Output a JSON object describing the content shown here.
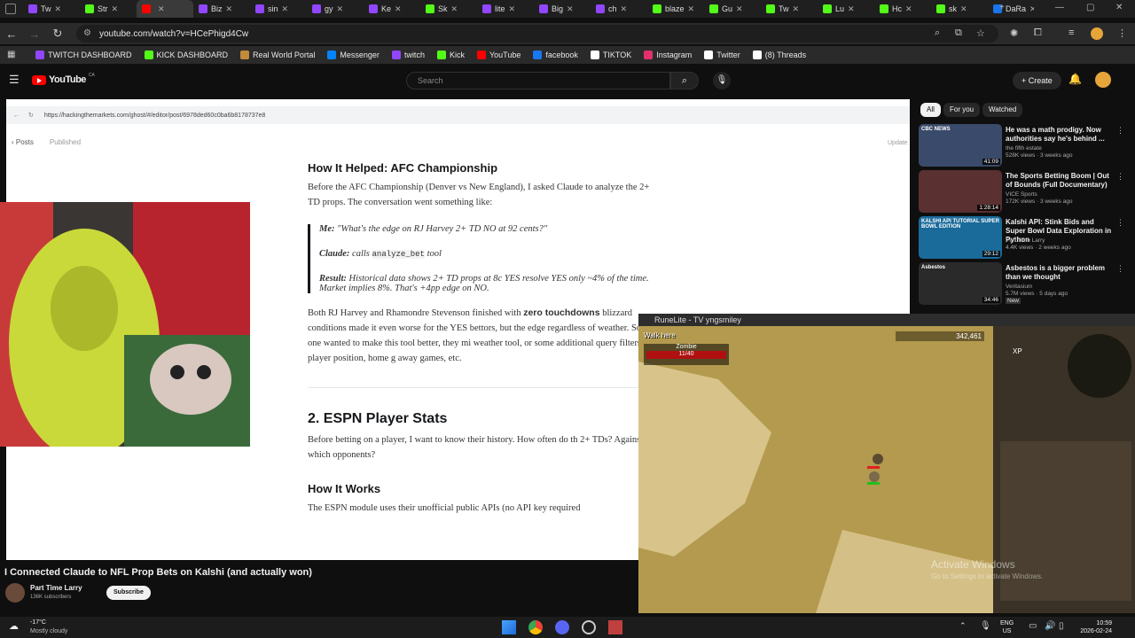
{
  "tabs": [
    "Tw",
    "Str",
    "",
    "Biz",
    "sin",
    "gy",
    "Ke",
    "Sk",
    "lite",
    "Big",
    "ch",
    "blaze",
    "Gu",
    "Tw",
    "Lu",
    "Hc",
    "sk",
    "DaRa"
  ],
  "browser": {
    "url": "youtube.com/watch?v=HCePhigd4Cw",
    "bookmarks": [
      "TWITCH DASHBOARD",
      "KICK DASHBOARD",
      "Real World Portal",
      "Messenger",
      "twitch",
      "Kick",
      "YouTube",
      "facebook",
      "TIKTOK",
      "Instagram",
      "Twitter",
      "(8) Threads"
    ]
  },
  "youtube": {
    "logo": "YouTube",
    "region": "CA",
    "search_placeholder": "Search",
    "create_label": "Create",
    "chips": [
      "All",
      "For you",
      "Watched"
    ],
    "video_title": "I Connected Claude to NFL Prop Bets on Kalshi (and actually won)",
    "channel": "Part Time Larry",
    "subscribers": "136K subscribers",
    "subscribe_label": "Subscribe",
    "recommendations": [
      {
        "title": "He was a math prodigy. Now authorities say he's behind ...",
        "channel": "the fifth estate",
        "meta": "528K views · 3 weeks ago",
        "duration": "41:09",
        "thumb_text": "CBC NEWS",
        "color": "#3a4a6a"
      },
      {
        "title": "The Sports Betting Boom | Out of Bounds (Full Documentary)",
        "channel": "VICE Sports",
        "meta": "172K views · 3 weeks ago",
        "duration": "1:28:14",
        "thumb_text": "",
        "color": "#5a3030"
      },
      {
        "title": "Kalshi API: Stink Bids and Super Bowl Data Exploration in Python",
        "channel": "Part Time Larry",
        "meta": "4.4K views · 2 weeks ago",
        "duration": "29:12",
        "thumb_text": "KALSHI API TUTORIAL SUPER BOWL EDITION",
        "color": "#1a6a9a"
      },
      {
        "title": "Asbestos is a bigger problem than we thought",
        "channel": "Veritasium",
        "meta": "5.7M views · 5 days ago",
        "duration": "34:46",
        "thumb_text": "Asbestos",
        "color": "#2a2a2a",
        "badge": "New"
      }
    ]
  },
  "editor": {
    "url": "https://hackingthemarkets.com/ghost/#/editor/post/6978ded60c0ba6b8178737e8",
    "back_label": "Posts",
    "status": "Published",
    "update_label": "Update"
  },
  "article": {
    "h3_1": "How It Helped: AFC Championship",
    "p1": "Before the AFC Championship (Denver vs New England), I asked Claude to analyze the 2+ TD props. The conversation went something like:",
    "q_me_label": "Me:",
    "q_me": "\"What's the edge on RJ Harvey 2+ TD NO at 92 cents?\"",
    "q_claude_label": "Claude:",
    "q_claude_pre": "calls",
    "q_claude_code": "analyze_bet",
    "q_claude_post": "tool",
    "q_result_label": "Result:",
    "q_result": "Historical data shows 2+ TD props at 8c YES resolve YES only ~4% of the time. Market implies 8%. That's +4pp edge on NO.",
    "p2_a": "Both RJ Harvey and Rhamondre Stevenson finished with",
    "p2_b": "zero touchdowns",
    "p2_c": "blizzard conditions made it even worse for the YES bettors, but the edge regardless of weather. So if one wanted to make this tool better, they mi weather tool, or some additional query filters on player position, home g away games, etc.",
    "h2": "2. ESPN Player Stats",
    "p3": "Before betting on a player, I want to know their history. How often do th 2+ TDs? Against which opponents?",
    "h3_2": "How It Works",
    "p4": "The ESPN module uses their unofficial public APIs (no API key required"
  },
  "runelite": {
    "title": "RuneLite - TV yngsmiley",
    "action": "Walk here",
    "target": "Zombie",
    "hp": "11/40",
    "coins": "342,461",
    "xp_label": "XP",
    "watermark_1": "Activate Windows",
    "watermark_2": "Go to Settings to activate Windows."
  },
  "taskbar": {
    "temp": "-17°C",
    "weather": "Mostly cloudy",
    "lang_1": "ENG",
    "lang_2": "US",
    "time": "10:59",
    "date": "2026-02-24"
  },
  "colors": {
    "yt_red": "#ff0000",
    "kick_green": "#53fc18",
    "twitch_purple": "#9146ff"
  }
}
